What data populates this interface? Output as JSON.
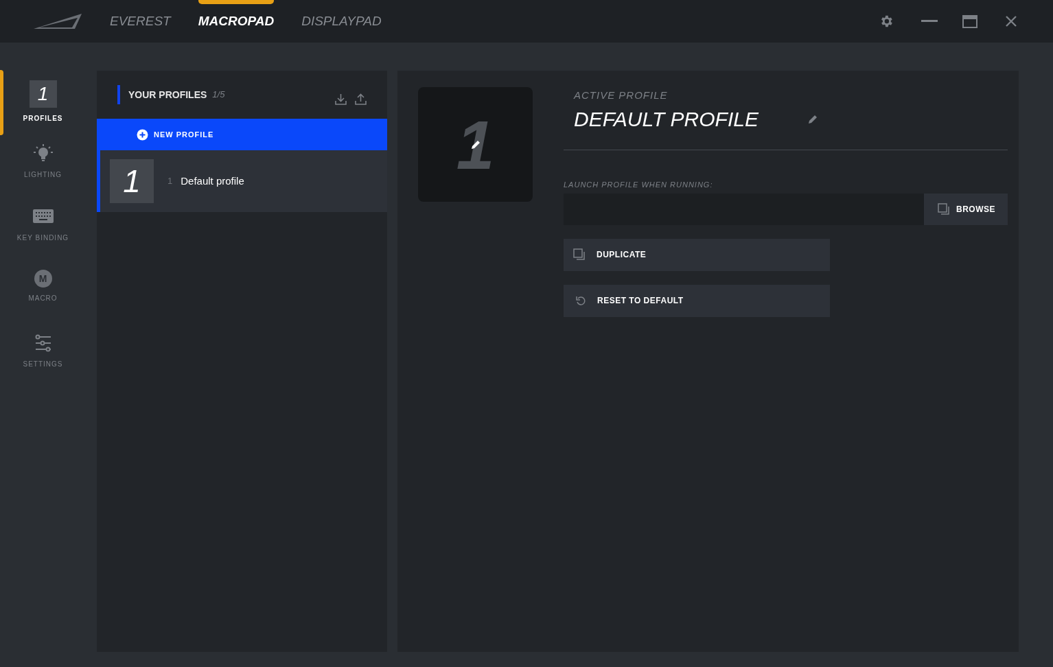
{
  "nav_tabs": [
    {
      "label": "EVEREST",
      "selected": false
    },
    {
      "label": "MACROPAD",
      "selected": true
    },
    {
      "label": "DISPLAYPAD",
      "selected": false
    }
  ],
  "sidebar": {
    "items": [
      {
        "label": "PROFILES",
        "kind": "number",
        "glyph": "1",
        "selected": true
      },
      {
        "label": "LIGHTING",
        "kind": "bulb",
        "selected": false
      },
      {
        "label": "KEY BINDING",
        "kind": "keyboard",
        "selected": false
      },
      {
        "label": "MACRO",
        "kind": "letter",
        "glyph": "M",
        "selected": false
      },
      {
        "label": "SETTINGS",
        "kind": "sliders",
        "selected": false
      }
    ]
  },
  "profiles_panel": {
    "title": "YOUR PROFILES",
    "count": "1/5",
    "new_profile": "NEW PROFILE",
    "profiles": [
      {
        "tile": "1",
        "index": "1",
        "name": "Default profile",
        "selected": true
      }
    ]
  },
  "active_profile": {
    "tile": "1",
    "label": "ACTIVE PROFILE",
    "name": "DEFAULT PROFILE",
    "launch_label": "LAUNCH PROFILE WHEN RUNNING:",
    "browse": "BROWSE",
    "actions": [
      {
        "kind": "duplicate",
        "label": "DUPLICATE"
      },
      {
        "kind": "reset",
        "label": "RESET TO DEFAULT"
      }
    ]
  }
}
